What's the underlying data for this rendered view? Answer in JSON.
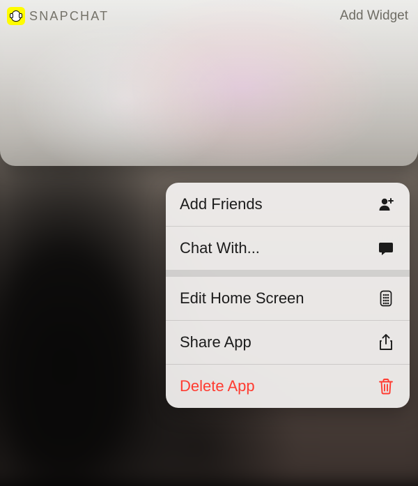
{
  "widget": {
    "app_name": "SNAPCHAT",
    "add_widget_label": "Add Widget"
  },
  "menu": {
    "items": [
      {
        "label": "Add Friends",
        "icon": "person-add-icon",
        "destructive": false
      },
      {
        "label": "Chat With...",
        "icon": "chat-icon",
        "destructive": false
      },
      {
        "label": "Edit Home Screen",
        "icon": "apps-grid-icon",
        "destructive": false
      },
      {
        "label": "Share App",
        "icon": "share-icon",
        "destructive": false
      },
      {
        "label": "Delete App",
        "icon": "trash-icon",
        "destructive": true
      }
    ]
  },
  "colors": {
    "destructive": "#ff3b30",
    "brand": "#FFFC00"
  }
}
